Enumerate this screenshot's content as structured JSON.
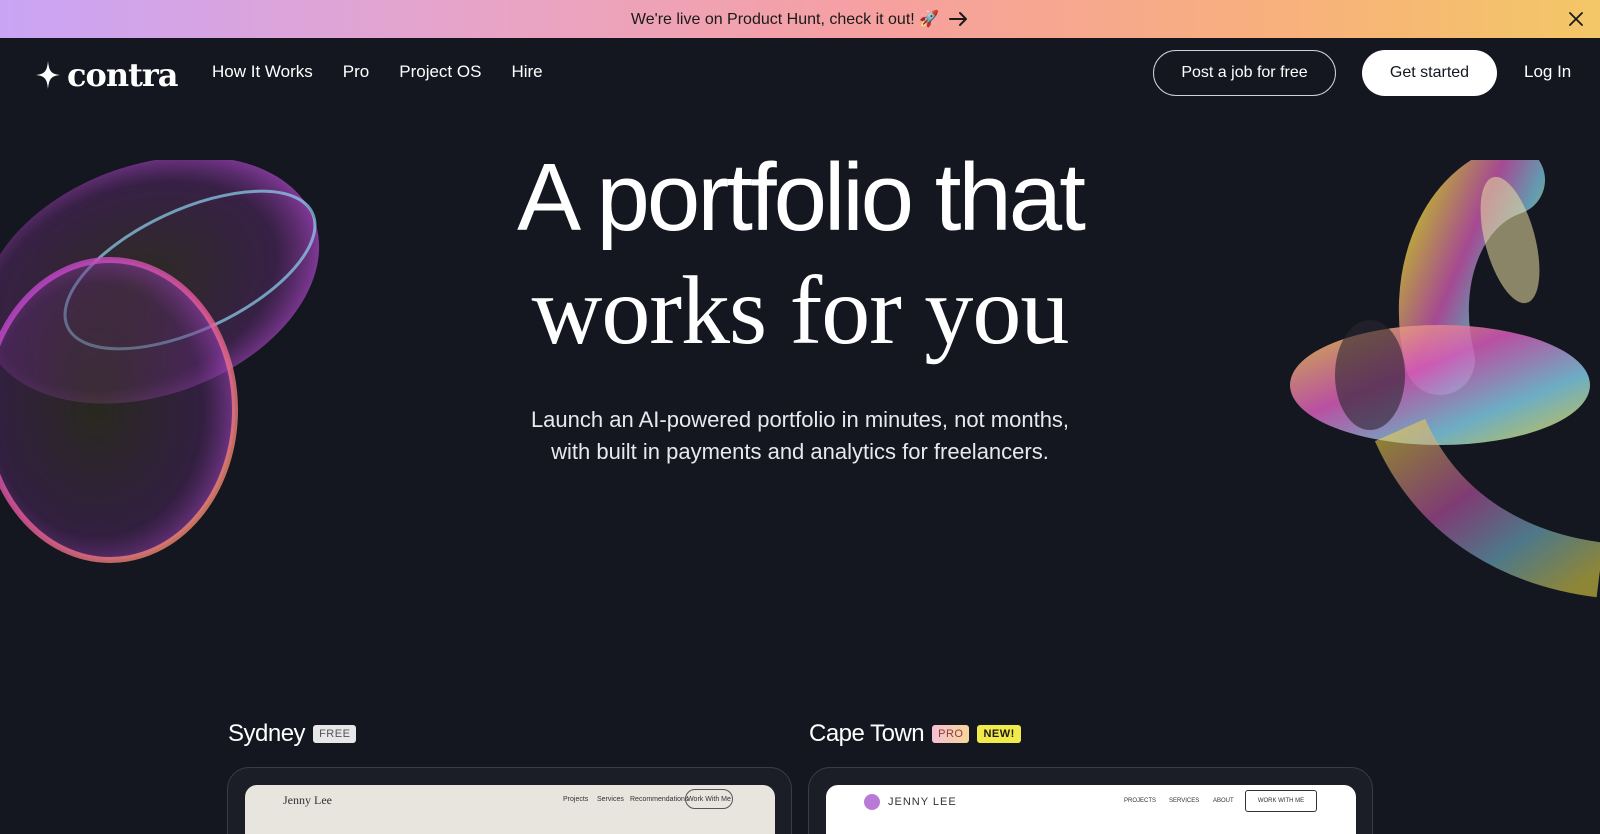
{
  "banner": {
    "text": "We're live on Product Hunt, check it out! 🚀",
    "arrow_icon": "arrow-right-icon",
    "close_icon": "close-icon",
    "gradient": [
      "#c9a4f6",
      "#f6a0a0",
      "#f3c766"
    ]
  },
  "nav": {
    "logo": "contra",
    "links": [
      "How It Works",
      "Pro",
      "Project OS",
      "Hire"
    ],
    "post_job": "Post a job for free",
    "get_started": "Get started",
    "login": "Log In"
  },
  "hero": {
    "line1": "A portfolio that",
    "line2": "works for you",
    "sub1": "Launch an AI-powered portfolio in minutes, not months,",
    "sub2": "with built in payments and analytics for freelancers."
  },
  "templates": [
    {
      "name": "Sydney",
      "badges": [
        "FREE"
      ],
      "preview": {
        "owner": "Jenny Lee",
        "nav": [
          "Projects",
          "Services",
          "Recommendations"
        ],
        "cta": "Work With Me"
      }
    },
    {
      "name": "Cape Town",
      "badges": [
        "PRO",
        "NEW!"
      ],
      "preview": {
        "owner": "JENNY LEE",
        "nav": [
          "PROJECTS",
          "SERVICES",
          "ABOUT"
        ],
        "cta": "WORK WITH ME"
      }
    }
  ],
  "colors": {
    "background": "#141720",
    "card_border": "#3a3d46",
    "new_badge": "#f2ea4b"
  }
}
